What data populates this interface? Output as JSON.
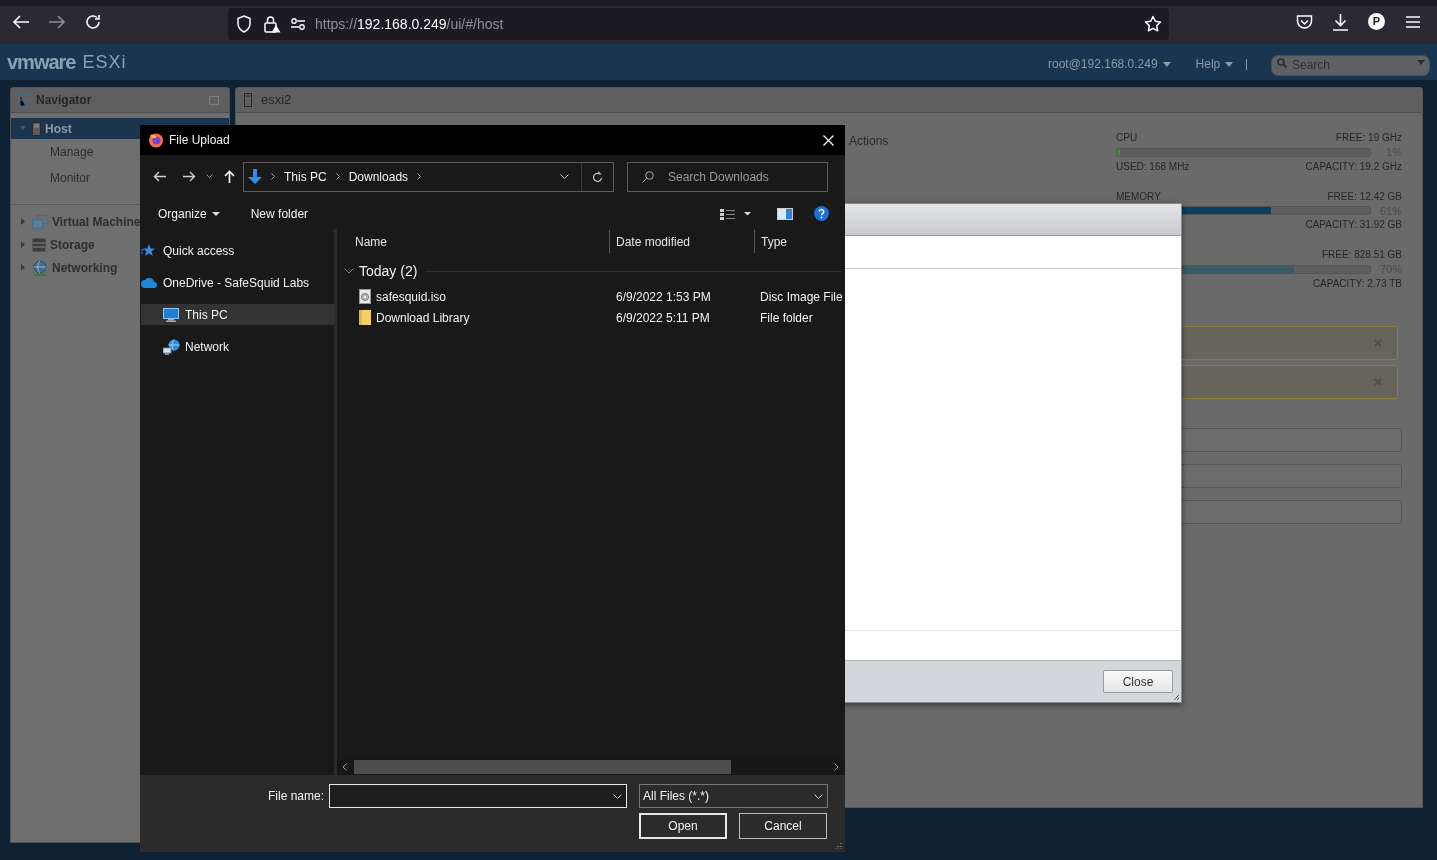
{
  "browser": {
    "url": {
      "scheme": "https://",
      "host": "192.168.0.249",
      "path": "/ui/#/host"
    },
    "profile_initial": "P"
  },
  "esxi_header": {
    "brand": "vmware",
    "product": "ESXi",
    "user_menu": "root@192.168.0.249",
    "help_menu": "Help",
    "search": {
      "placeholder": "Search"
    }
  },
  "navigator": {
    "title": "Navigator",
    "items": [
      {
        "label": "Host",
        "kind": "host",
        "selected": true,
        "expanded": true,
        "children": [
          {
            "label": "Manage",
            "selected": false
          },
          {
            "label": "Monitor",
            "selected": false
          }
        ]
      },
      {
        "label": "Virtual Machine",
        "kind": "vms",
        "selected": false,
        "expanded": false
      },
      {
        "label": "Storage",
        "kind": "storage",
        "selected": false,
        "expanded": false
      },
      {
        "label": "Networking",
        "kind": "network",
        "selected": false,
        "expanded": false
      }
    ]
  },
  "main": {
    "title": "esxi2",
    "toolbar": {
      "actions": "Actions"
    },
    "stats": [
      {
        "label": "CPU",
        "free": "FREE: 19 GHz",
        "level": 0.01,
        "percent": "1%",
        "used": "USED: 168 MHz",
        "capacity": "CAPACITY: 19.2 GHz",
        "color": "#3f8f2a"
      },
      {
        "label": "MEMORY",
        "free": "FREE: 12.42 GB",
        "level": 0.61,
        "percent": "61%",
        "capacity": "CAPACITY: 31.92 GB",
        "color": "#0b3f5e"
      },
      {
        "free": "FREE: 828.51 GB",
        "level": 0.7,
        "percent": "70%",
        "capacity": "CAPACITY: 2.73 TB",
        "color": "#3a5a66"
      }
    ],
    "notices": [
      {
        "kind": "warning"
      },
      {
        "kind": "warning"
      },
      {
        "kind": "collapsed"
      },
      {
        "kind": "collapsed"
      },
      {
        "kind": "collapsed"
      }
    ]
  },
  "modal": {
    "close_button": "Close"
  },
  "file_dialog": {
    "title": "File Upload",
    "path": [
      "This PC",
      "Downloads"
    ],
    "search": {
      "placeholder": "Search Downloads"
    },
    "toolbar": {
      "organize": "Organize",
      "new_folder": "New folder"
    },
    "sidebar": [
      {
        "label": "Quick access",
        "kind": "star",
        "selected": false
      },
      {
        "label": "OneDrive - SafeSquid Labs",
        "kind": "cloud",
        "selected": false
      },
      {
        "label": "This PC",
        "kind": "pc",
        "selected": true
      },
      {
        "label": "Network",
        "kind": "network",
        "selected": false
      }
    ],
    "columns": [
      "Name",
      "Date modified",
      "Type"
    ],
    "groups": [
      {
        "label": "Today (2)",
        "expanded": true,
        "files": [
          {
            "name": "safesquid.iso",
            "date": "6/9/2022 1:53 PM",
            "type": "Disc Image File",
            "kind": "disc"
          },
          {
            "name": "Download Library",
            "date": "6/9/2022 5:11 PM",
            "type": "File folder",
            "kind": "folder"
          }
        ]
      }
    ],
    "file_name": {
      "label": "File name:"
    },
    "filter": "All Files (*.*)",
    "open_button": "Open",
    "cancel_button": "Cancel"
  }
}
